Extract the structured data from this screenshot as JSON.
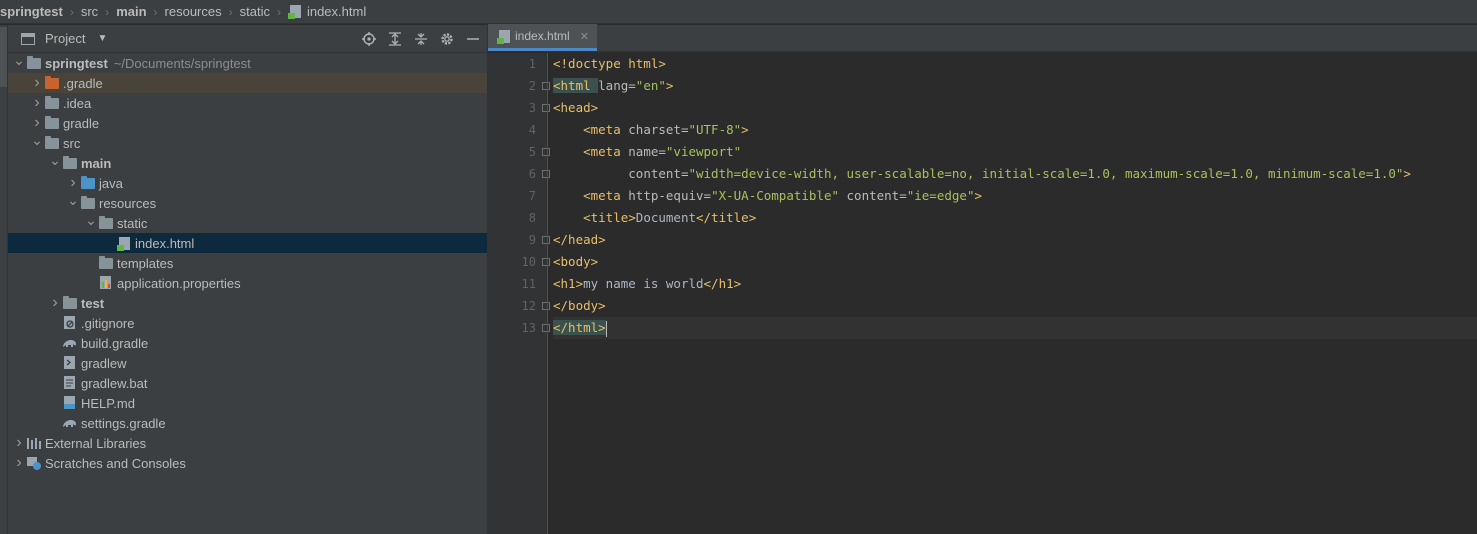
{
  "breadcrumb": [
    "springtest",
    "src",
    "main",
    "resources",
    "static",
    "index.html"
  ],
  "project_panel": {
    "title": "Project",
    "tools": [
      "locate-icon",
      "expand-all-icon",
      "collapse-all-icon",
      "gear-icon",
      "minimize-icon"
    ]
  },
  "tree": [
    {
      "level": 0,
      "arrow": "down",
      "icon": "module-folder",
      "label": "springtest",
      "bold": true,
      "path": "~/Documents/springtest"
    },
    {
      "level": 1,
      "arrow": "right",
      "icon": "orange-folder",
      "label": ".gradle",
      "highlight": true
    },
    {
      "level": 1,
      "arrow": "right",
      "icon": "folder",
      "label": ".idea"
    },
    {
      "level": 1,
      "arrow": "right",
      "icon": "folder",
      "label": "gradle"
    },
    {
      "level": 1,
      "arrow": "down",
      "icon": "folder",
      "label": "src"
    },
    {
      "level": 2,
      "arrow": "down",
      "icon": "module-folder",
      "label": "main",
      "bold": true
    },
    {
      "level": 3,
      "arrow": "right",
      "icon": "blue-folder",
      "label": "java"
    },
    {
      "level": 3,
      "arrow": "down",
      "icon": "resources-folder",
      "label": "resources"
    },
    {
      "level": 4,
      "arrow": "down",
      "icon": "folder",
      "label": "static"
    },
    {
      "level": 5,
      "arrow": "",
      "icon": "html-file",
      "label": "index.html",
      "selected": true
    },
    {
      "level": 4,
      "arrow": "",
      "icon": "folder",
      "label": "templates"
    },
    {
      "level": 4,
      "arrow": "",
      "icon": "properties-file",
      "label": "application.properties"
    },
    {
      "level": 2,
      "arrow": "right",
      "icon": "module-folder",
      "label": "test",
      "bold": true
    },
    {
      "level": 2,
      "arrow": "",
      "icon": "gitignore-file",
      "label": ".gitignore"
    },
    {
      "level": 2,
      "arrow": "",
      "icon": "gradle-file",
      "label": "build.gradle"
    },
    {
      "level": 2,
      "arrow": "",
      "icon": "shell-file",
      "label": "gradlew"
    },
    {
      "level": 2,
      "arrow": "",
      "icon": "text-file",
      "label": "gradlew.bat"
    },
    {
      "level": 2,
      "arrow": "",
      "icon": "markdown-file",
      "label": "HELP.md"
    },
    {
      "level": 2,
      "arrow": "",
      "icon": "gradle-file",
      "label": "settings.gradle"
    },
    {
      "level": 0,
      "arrow": "right",
      "icon": "libraries",
      "label": "External Libraries"
    },
    {
      "level": 0,
      "arrow": "right",
      "icon": "scratches",
      "label": "Scratches and Consoles"
    }
  ],
  "editor": {
    "tab_label": "index.html",
    "line_numbers": [
      "1",
      "2",
      "3",
      "4",
      "5",
      "6",
      "7",
      "8",
      "9",
      "10",
      "11",
      "12",
      "13"
    ],
    "lines": [
      [
        [
          "tag",
          "<!doctype html>"
        ]
      ],
      [
        [
          "tag",
          "<html "
        ],
        [
          "attr",
          "lang="
        ],
        [
          "val",
          "\"en\""
        ],
        [
          "tag",
          ">"
        ]
      ],
      [
        [
          "tag",
          "<head>"
        ]
      ],
      [
        [
          "txt",
          "    "
        ],
        [
          "tag",
          "<meta "
        ],
        [
          "attr",
          "charset="
        ],
        [
          "val",
          "\"UTF-8\""
        ],
        [
          "tag",
          ">"
        ]
      ],
      [
        [
          "txt",
          "    "
        ],
        [
          "tag",
          "<meta "
        ],
        [
          "attr",
          "name="
        ],
        [
          "val",
          "\"viewport\""
        ]
      ],
      [
        [
          "txt",
          "          "
        ],
        [
          "attr",
          "content="
        ],
        [
          "val",
          "\"width=device-width, user-scalable=no, initial-scale=1.0, maximum-scale=1.0, minimum-scale=1.0\""
        ],
        [
          "tag",
          ">"
        ]
      ],
      [
        [
          "txt",
          "    "
        ],
        [
          "tag",
          "<meta "
        ],
        [
          "attr",
          "http-equiv="
        ],
        [
          "val",
          "\"X-UA-Compatible\""
        ],
        [
          "attr",
          " content="
        ],
        [
          "val",
          "\"ie=edge\""
        ],
        [
          "tag",
          ">"
        ]
      ],
      [
        [
          "txt",
          "    "
        ],
        [
          "tag",
          "<title>"
        ],
        [
          "txt",
          "Document"
        ],
        [
          "tag",
          "</title>"
        ]
      ],
      [
        [
          "tag",
          "</head>"
        ]
      ],
      [
        [
          "tag",
          "<body>"
        ]
      ],
      [
        [
          "tag",
          "<h1>"
        ],
        [
          "txt",
          "my name is world"
        ],
        [
          "tag",
          "</h1>"
        ]
      ],
      [
        [
          "tag",
          "</body>"
        ]
      ],
      [
        [
          "tag",
          "</html>"
        ]
      ]
    ]
  },
  "colors": {
    "tag": "#e8bf6a",
    "attr": "#bababa",
    "value": "#a5c25c",
    "selection": "#0d293e"
  }
}
